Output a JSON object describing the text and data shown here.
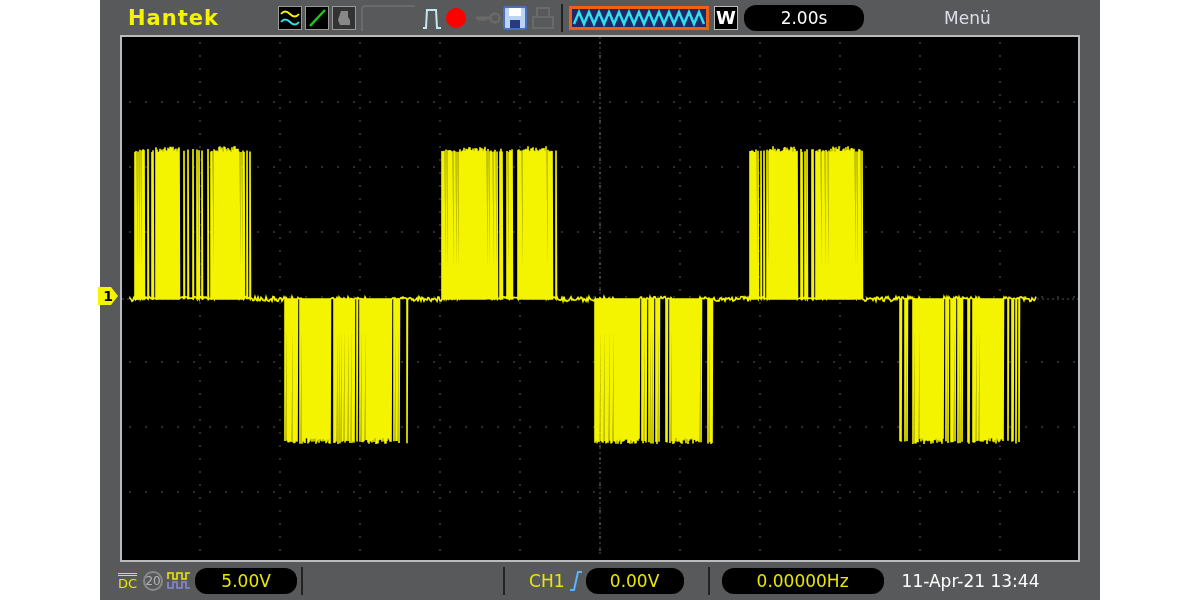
{
  "top_bar": {
    "brand": "Hantek",
    "timebase_mode": "W",
    "timebase": "2.00s",
    "menu": "Menü"
  },
  "display": {
    "channel_marker": "1"
  },
  "bottom_bar": {
    "coupling": "DC",
    "bandwidth_limit": {
      "label": "20",
      "on": false
    },
    "volts_per_div": "5.00V",
    "trigger_source": "CH1",
    "trigger_level": "0.00V",
    "frequency": "0.00000Hz",
    "datetime": "11-Apr-21 13:44"
  }
}
